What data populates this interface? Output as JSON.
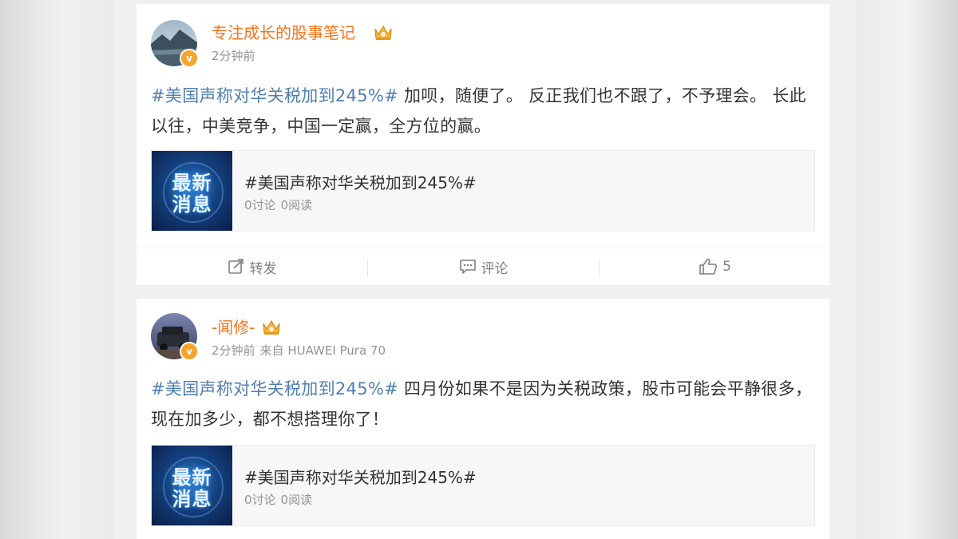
{
  "posts": [
    {
      "username": "专注成长的股事笔记",
      "time": "2分钟前",
      "source": "",
      "topic": "#美国声称对华关税加到245%#",
      "text": " 加呗，随便了。 反正我们也不跟了，不予理会。 长此以往，中美竞争，中国一定赢，全方位的赢。",
      "link_card": {
        "thumb_line1": "最新",
        "thumb_line2": "消息",
        "title": "#美国声称对华关税加到245%#",
        "discussions": "0讨论",
        "reads": "0阅读"
      },
      "actions": {
        "repost": "转发",
        "comment": "评论",
        "likes": "5"
      }
    },
    {
      "username": "-闻修-",
      "time": "2分钟前",
      "source": "来自 HUAWEI Pura 70",
      "topic": "#美国声称对华关税加到245%#",
      "text": " 四月份如果不是因为关税政策，股市可能会平静很多，现在加多少，都不想搭理你了！",
      "link_card": {
        "thumb_line1": "最新",
        "thumb_line2": "消息",
        "title": "#美国声称对华关税加到245%#",
        "discussions": "0讨论",
        "reads": "0阅读"
      }
    }
  ],
  "colors": {
    "username": "#f5741d",
    "topic_link": "#4f7fb0",
    "verified_badge": "#f7a42c",
    "muted_text": "#939393"
  },
  "icons": [
    "verified-badge-icon",
    "crown-badge-icon",
    "repost-icon",
    "comment-icon",
    "like-icon"
  ]
}
